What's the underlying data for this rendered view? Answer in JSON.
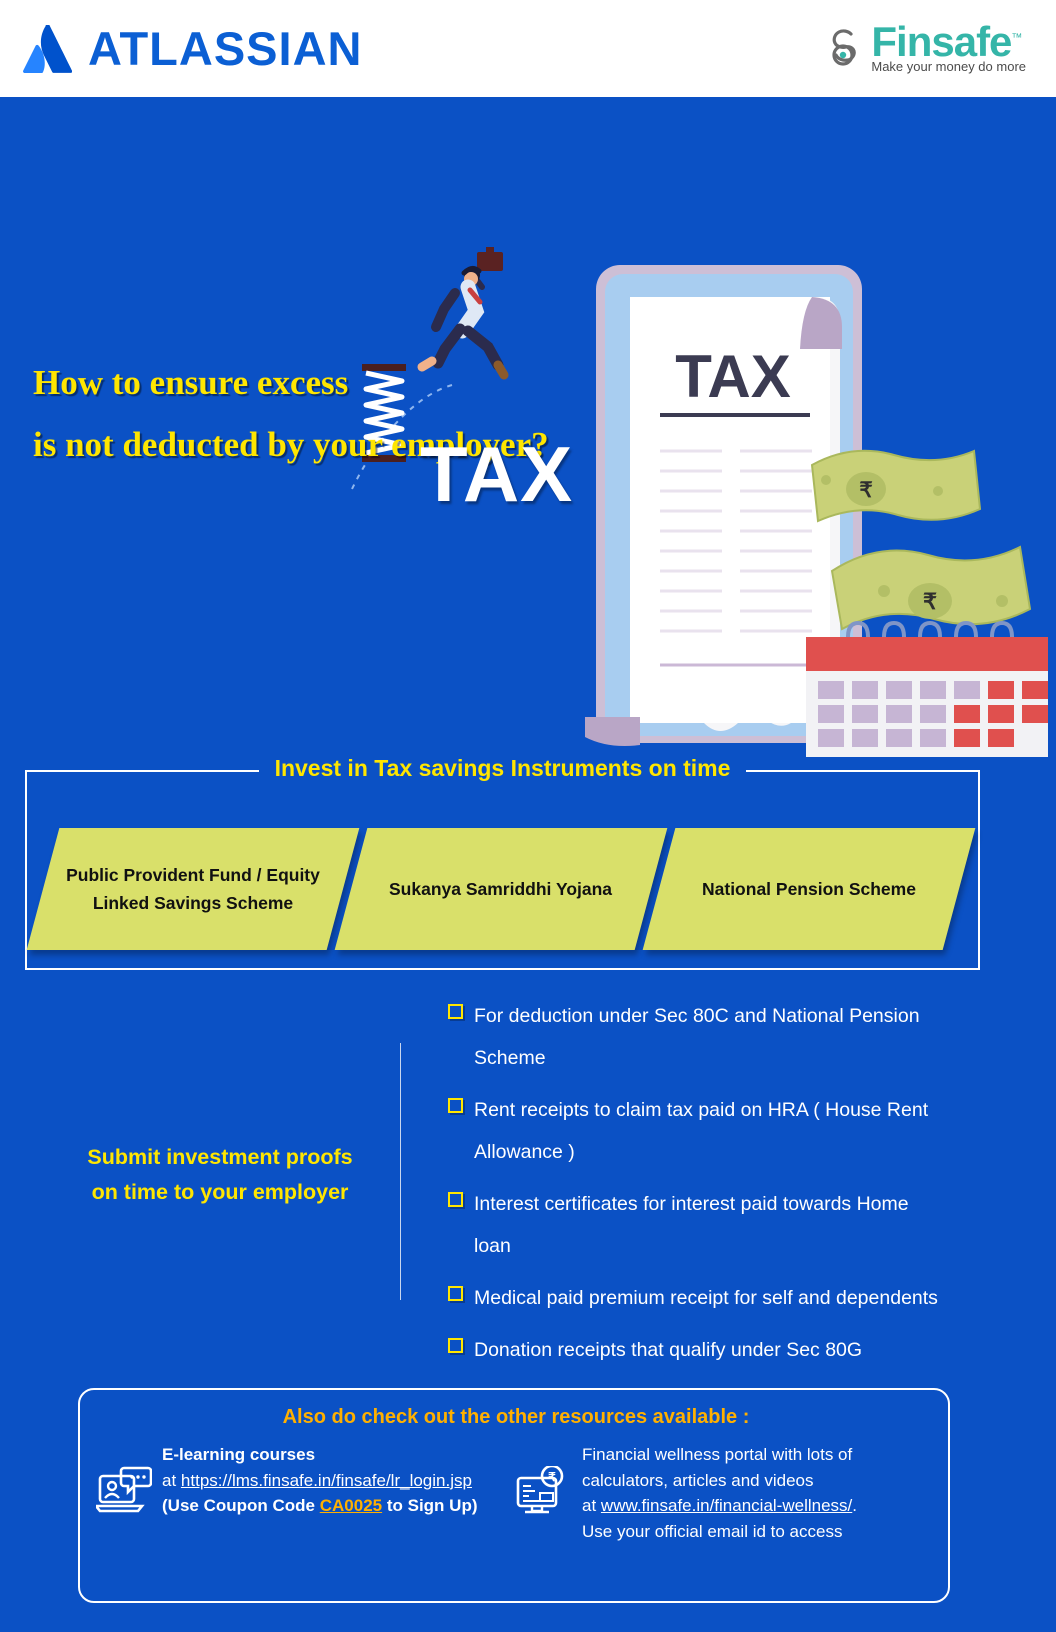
{
  "header": {
    "atlassian_name": "ATLASSIAN",
    "finsafe_name": "Finsafe",
    "finsafe_tm": "™",
    "finsafe_tagline": "Make your money do more"
  },
  "hero": {
    "headline_line1": "How to ensure excess",
    "headline_line2": "is not deducted by your employer?",
    "tax_word": "TAX",
    "document_title": "TAX",
    "currency_symbol": "₹"
  },
  "invest": {
    "title": "Invest in Tax savings Instruments on time",
    "cards": [
      {
        "label": "Public Provident Fund / Equity Linked Savings Scheme"
      },
      {
        "label": "Sukanya Samriddhi Yojana"
      },
      {
        "label": "National Pension Scheme"
      }
    ]
  },
  "proofs": {
    "label_line1": "Submit investment proofs",
    "label_line2": "on time to your employer",
    "items": [
      "For deduction under Sec 80C and National Pension Scheme",
      "Rent receipts to claim tax paid on HRA ( House Rent Allowance )",
      "Interest certificates for interest paid towards Home loan",
      "Medical paid premium receipt for self and dependents",
      "Donation receipts that qualify under Sec 80G"
    ]
  },
  "resources": {
    "title": "Also do check out the other resources available :",
    "left": {
      "heading": "E-learning courses",
      "at_label": "at",
      "link": "https://lms.finsafe.in/finsafe/lr_login.jsp",
      "coupon_prefix": "(Use Coupon Code",
      "coupon_code": "CA0025",
      "coupon_suffix": "to Sign Up)"
    },
    "right": {
      "line1": "Financial wellness portal with lots of",
      "line2": "calculators, articles and videos",
      "at_label": "at",
      "link": "www.finsafe.in/financial-wellness/",
      "line_end": ".",
      "line4": "Use your official email id to access"
    }
  },
  "colors": {
    "background": "#0b51c5",
    "accent_yellow": "#ffe600",
    "accent_orange": "#ffb000",
    "card_green": "#d9e06a",
    "atlassian_blue": "#0b5fd4",
    "finsafe_teal": "#35b5a8"
  }
}
